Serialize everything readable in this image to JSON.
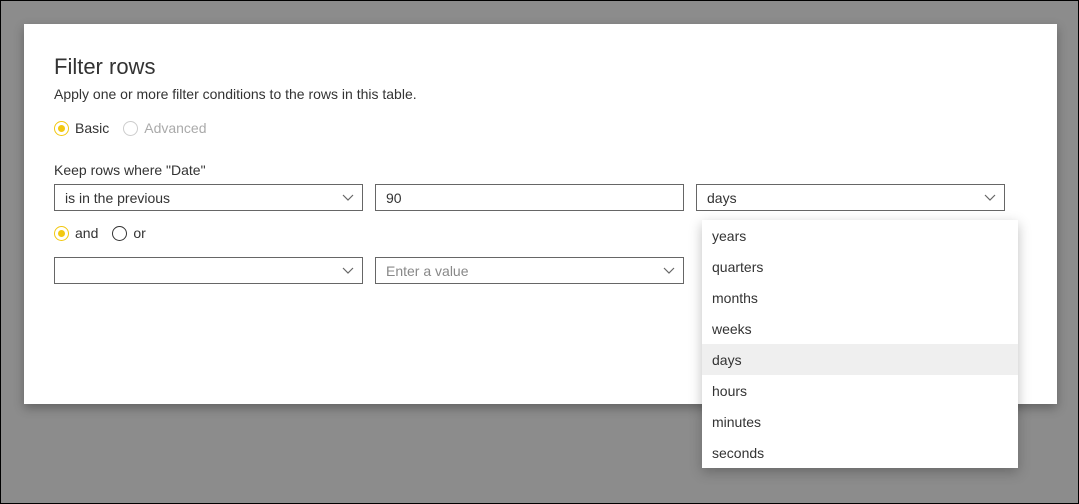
{
  "dialog": {
    "title": "Filter rows",
    "subtitle": "Apply one or more filter conditions to the rows in this table."
  },
  "mode": {
    "basic": "Basic",
    "advanced": "Advanced"
  },
  "hint": "Keep rows where \"Date\"",
  "row1": {
    "operator": "is in the previous",
    "value": "90",
    "unit": "days"
  },
  "logic": {
    "and": "and",
    "or": "or"
  },
  "row2": {
    "operator": "",
    "value_placeholder": "Enter a value",
    "unit": ""
  },
  "unit_options": [
    "years",
    "quarters",
    "months",
    "weeks",
    "days",
    "hours",
    "minutes",
    "seconds"
  ],
  "unit_selected": "days"
}
